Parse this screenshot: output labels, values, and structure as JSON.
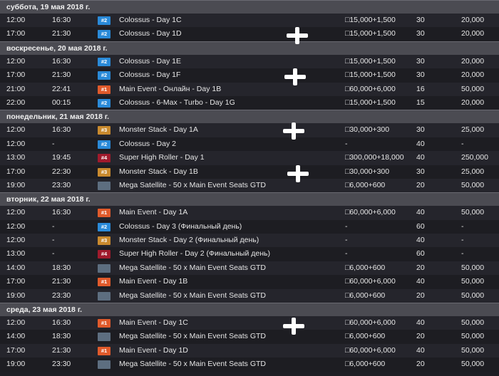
{
  "colors": {
    "background": "#1e1e24",
    "day_header": "#4b4b52",
    "badge_1": "#e05a2b",
    "badge_2": "#2a8ad8",
    "badge_3": "#c98a2e",
    "badge_4": "#a01a2c",
    "badge_sat": "#5d6e80"
  },
  "days": [
    {
      "header": "суббота, 19 мая 2018 г.",
      "events": [
        {
          "start": "12:00",
          "late": "16:30",
          "badge": "#2",
          "badge_type": "2",
          "name": "Colossus  - Day 1C",
          "buyin": "□15,000+1,500",
          "levels": "30",
          "gtd": "20,000"
        },
        {
          "start": "17:00",
          "late": "21:30",
          "badge": "#2",
          "badge_type": "2",
          "name": "Colossus  - Day 1D",
          "buyin": "□15,000+1,500",
          "levels": "30",
          "gtd": "20,000"
        }
      ]
    },
    {
      "header": "воскресенье, 20 мая 2018 г.",
      "events": [
        {
          "start": "12:00",
          "late": "16:30",
          "badge": "#2",
          "badge_type": "2",
          "name": "Colossus  - Day 1E",
          "buyin": "□15,000+1,500",
          "levels": "30",
          "gtd": "20,000"
        },
        {
          "start": "17:00",
          "late": "21:30",
          "badge": "#2",
          "badge_type": "2",
          "name": "Colossus  - Day 1F",
          "buyin": "□15,000+1,500",
          "levels": "30",
          "gtd": "20,000"
        },
        {
          "start": "21:00",
          "late": "22:41",
          "badge": "#1",
          "badge_type": "1",
          "name": "Main Event - Онлайн - Day 1B",
          "buyin": "□60,000+6,000",
          "levels": "16",
          "gtd": "50,000"
        },
        {
          "start": "22:00",
          "late": "00:15",
          "badge": "#2",
          "badge_type": "2",
          "name": "Colossus - 6-Max - Turbo - Day 1G",
          "buyin": "□15,000+1,500",
          "levels": "15",
          "gtd": "20,000"
        }
      ]
    },
    {
      "header": "понедельник, 21 мая 2018 г.",
      "events": [
        {
          "start": "12:00",
          "late": "16:30",
          "badge": "#3",
          "badge_type": "3",
          "name": "Monster Stack  - Day 1A",
          "buyin": "□30,000+300",
          "levels": "30",
          "gtd": "25,000"
        },
        {
          "start": "12:00",
          "late": "-",
          "badge": "#2",
          "badge_type": "2",
          "name": "Colossus  - Day 2",
          "buyin": "-",
          "levels": "40",
          "gtd": "-"
        },
        {
          "start": "13:00",
          "late": "19:45",
          "badge": "#4",
          "badge_type": "4",
          "name": "Super High Roller  - Day 1",
          "buyin": "□300,000+18,000",
          "levels": "40",
          "gtd": "250,000"
        },
        {
          "start": "17:00",
          "late": "22:30",
          "badge": "#3",
          "badge_type": "3",
          "name": "Monster Stack  - Day 1B",
          "buyin": "□30,000+300",
          "levels": "30",
          "gtd": "25,000"
        },
        {
          "start": "19:00",
          "late": "23:30",
          "badge": "",
          "badge_type": "sat",
          "name": "Mega Satellite - 50 x Main Event Seats GTD",
          "buyin": "□6,000+600",
          "levels": "20",
          "gtd": "50,000"
        }
      ]
    },
    {
      "header": "вторник, 22 мая 2018 г.",
      "events": [
        {
          "start": "12:00",
          "late": "16:30",
          "badge": "#1",
          "badge_type": "1",
          "name": "Main Event  - Day 1A",
          "buyin": "□60,000+6,000",
          "levels": "40",
          "gtd": "50,000"
        },
        {
          "start": "12:00",
          "late": "-",
          "badge": "#2",
          "badge_type": "2",
          "name": "Colossus  - Day 3  (Финальный день)",
          "buyin": "-",
          "levels": "60",
          "gtd": "-"
        },
        {
          "start": "12:00",
          "late": "-",
          "badge": "#3",
          "badge_type": "3",
          "name": "Monster Stack  - Day 2  (Финальный день)",
          "buyin": "-",
          "levels": "40",
          "gtd": "-"
        },
        {
          "start": "13:00",
          "late": "-",
          "badge": "#4",
          "badge_type": "4",
          "name": "Super High Roller  - Day 2  (Финальный день)",
          "buyin": "-",
          "levels": "60",
          "gtd": "-"
        },
        {
          "start": "14:00",
          "late": "18:30",
          "badge": "",
          "badge_type": "sat",
          "name": "Mega Satellite - 50 x Main Event Seats GTD",
          "buyin": "□6,000+600",
          "levels": "20",
          "gtd": "50,000"
        },
        {
          "start": "17:00",
          "late": "21:30",
          "badge": "#1",
          "badge_type": "1",
          "name": "Main Event  - Day 1B",
          "buyin": "□60,000+6,000",
          "levels": "40",
          "gtd": "50,000"
        },
        {
          "start": "19:00",
          "late": "23:30",
          "badge": "",
          "badge_type": "sat",
          "name": "Mega Satellite - 50 x Main Event Seats GTD",
          "buyin": "□6,000+600",
          "levels": "20",
          "gtd": "50,000"
        }
      ]
    },
    {
      "header": "среда, 23 мая 2018 г.",
      "events": [
        {
          "start": "12:00",
          "late": "16:30",
          "badge": "#1",
          "badge_type": "1",
          "name": "Main Event  - Day 1C",
          "buyin": "□60,000+6,000",
          "levels": "40",
          "gtd": "50,000"
        },
        {
          "start": "14:00",
          "late": "18:30",
          "badge": "",
          "badge_type": "sat",
          "name": "Mega Satellite - 50 x Main Event Seats GTD",
          "buyin": "□6,000+600",
          "levels": "20",
          "gtd": "50,000"
        },
        {
          "start": "17:00",
          "late": "21:30",
          "badge": "#1",
          "badge_type": "1",
          "name": "Main Event  - Day 1D",
          "buyin": "□60,000+6,000",
          "levels": "40",
          "gtd": "50,000"
        },
        {
          "start": "19:00",
          "late": "23:30",
          "badge": "",
          "badge_type": "sat",
          "name": "Mega Satellite - 50 x Main Event Seats GTD",
          "buyin": "□6,000+600",
          "levels": "20",
          "gtd": "50,000"
        }
      ]
    }
  ],
  "annotations": [
    {
      "icon": "plus-icon"
    },
    {
      "icon": "plus-icon"
    },
    {
      "icon": "plus-icon"
    },
    {
      "icon": "plus-icon"
    },
    {
      "icon": "plus-icon"
    }
  ]
}
